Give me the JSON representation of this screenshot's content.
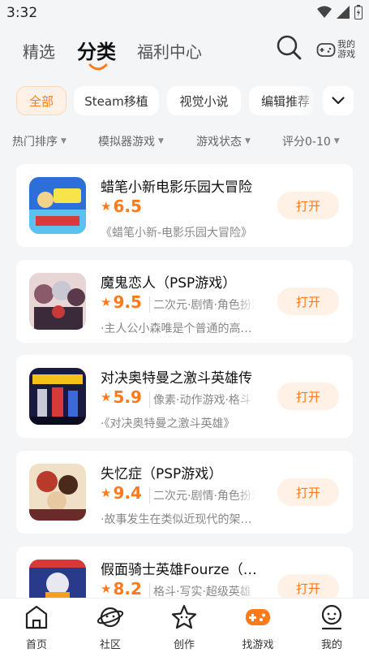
{
  "status_bar": {
    "time": "3:32"
  },
  "header": {
    "tabs": [
      {
        "label": "精选"
      },
      {
        "label": "分类"
      },
      {
        "label": "福利中心"
      }
    ],
    "my_games_label": "我的游戏"
  },
  "chips": [
    {
      "label": "全部"
    },
    {
      "label": "Steam移植"
    },
    {
      "label": "视觉小说"
    },
    {
      "label": "编辑推荐"
    }
  ],
  "filters": [
    {
      "label": "热门排序"
    },
    {
      "label": "模拟器游戏"
    },
    {
      "label": "游戏状态"
    },
    {
      "label": "评分0-10"
    }
  ],
  "games": [
    {
      "title": "蜡笔小新电影乐园大冒险",
      "score": "6.5",
      "tags": "",
      "desc": "《蜡笔小新-电影乐园大冒险》",
      "button": "打开"
    },
    {
      "title": "魔鬼恋人（PSP游戏）",
      "score": "9.5",
      "tags": "二次元·剧情·角色扮演",
      "desc": "·主人公小森唯是个普通的高中生",
      "button": "打开"
    },
    {
      "title": "对决奥特曼之激斗英雄传",
      "score": "5.9",
      "tags": "像素·动作游戏·格斗",
      "desc": "·《对决奥特曼之激斗英雄》",
      "button": "打开"
    },
    {
      "title": "失忆症（PSP游戏）",
      "score": "9.4",
      "tags": "二次元·剧情·角色扮演",
      "desc": "·故事发生在类似近现代的架空世界",
      "button": "打开"
    },
    {
      "title": "假面骑士英雄Fourze（PSP游戏）",
      "score": "8.2",
      "tags": "格斗·写实·超级英雄",
      "desc": "",
      "button": "打开"
    }
  ],
  "bottom_nav": [
    {
      "label": "首页"
    },
    {
      "label": "社区"
    },
    {
      "label": "创作"
    },
    {
      "label": "找游戏"
    },
    {
      "label": "我的"
    }
  ],
  "colors": {
    "accent": "#ff7a1a",
    "accent_bg": "#fff1e6"
  }
}
